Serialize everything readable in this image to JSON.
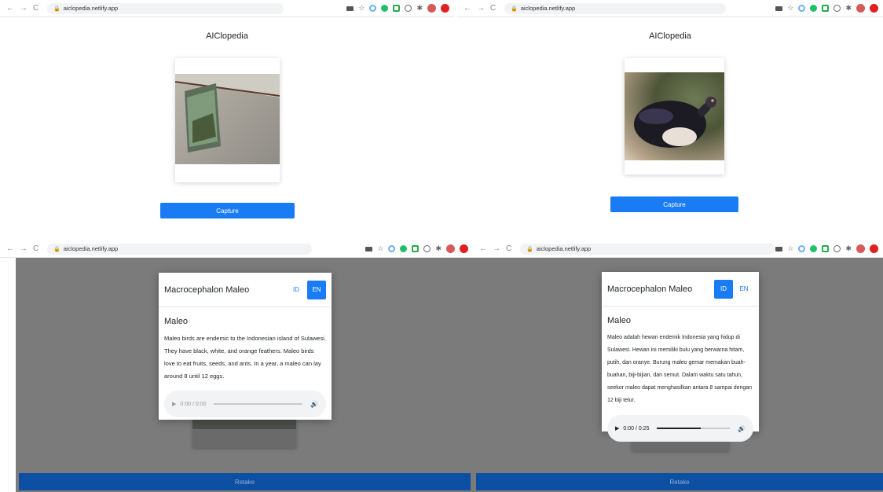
{
  "browser": {
    "url": "aiclopedia.netlify.app",
    "back": "←",
    "forward": "→",
    "reload": "C"
  },
  "app": {
    "title": "AIClopedia",
    "capture_label": "Capture",
    "retake_label": "Retake"
  },
  "result_en": {
    "header_title": "Macrocephalon Maleo",
    "lang_id": "ID",
    "lang_en": "EN",
    "active_lang": "EN",
    "name": "Maleo",
    "description": "Maleo birds are endemic to the Indonesian island of Sulawesi. They have black, white, and orange feathers. Maleo birds love to eat fruits, seeds, and ants. In a year, a maleo can lay around 8 until 12 eggs.",
    "audio_time": "0:00 / 0:00",
    "audio_progress": 0
  },
  "result_id": {
    "header_title": "Macrocephalon Maleo",
    "lang_id": "ID",
    "lang_en": "EN",
    "active_lang": "ID",
    "name": "Maleo",
    "description": "Maleo adalah hewan endemik Indonesia yang hidup di Sulawesi. Hewan ini memiliki bulu yang berwarna hitam, putih, dan oranye. Burung maleo gemar memakan buah-buahan, biji-bijian, dan semut. Dalam waktu satu tahun, seekor maleo dapat menghasilkan antara 8 sampai dengan 12 biji telur.",
    "audio_time": "0:00 / 0:25",
    "audio_progress": 0.6
  },
  "icons": {
    "play": "▶",
    "volume": "🔊",
    "lock": "🔒"
  },
  "colors": {
    "primary": "#1a7cf5",
    "retake": "#0d4fa3",
    "overlay": "#7b7b7b"
  }
}
